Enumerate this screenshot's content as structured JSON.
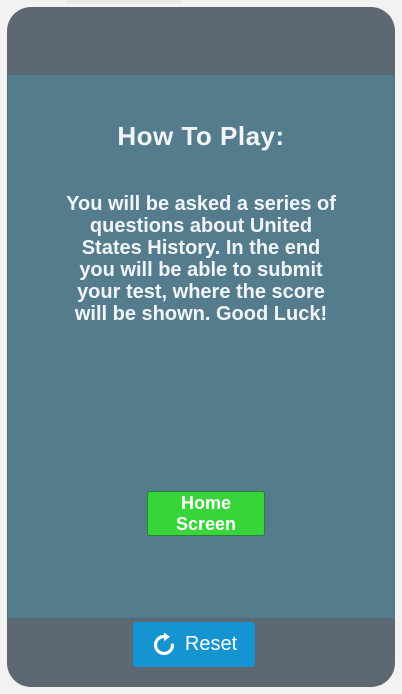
{
  "screen": {
    "title": "How To Play:",
    "instructions": "You will be asked a series of questions about United States History. In the end you will be able to submit your test, where the score will be shown. Good Luck!",
    "home_button_label": "Home\nScreen"
  },
  "footer": {
    "reset_label": "Reset",
    "reset_icon": "refresh-icon"
  },
  "colors": {
    "device_frame": "#5e6872",
    "screen_background": "#547c8c",
    "home_button": "#37d539",
    "reset_button": "#1693d1",
    "text": "#f2f5f8"
  }
}
